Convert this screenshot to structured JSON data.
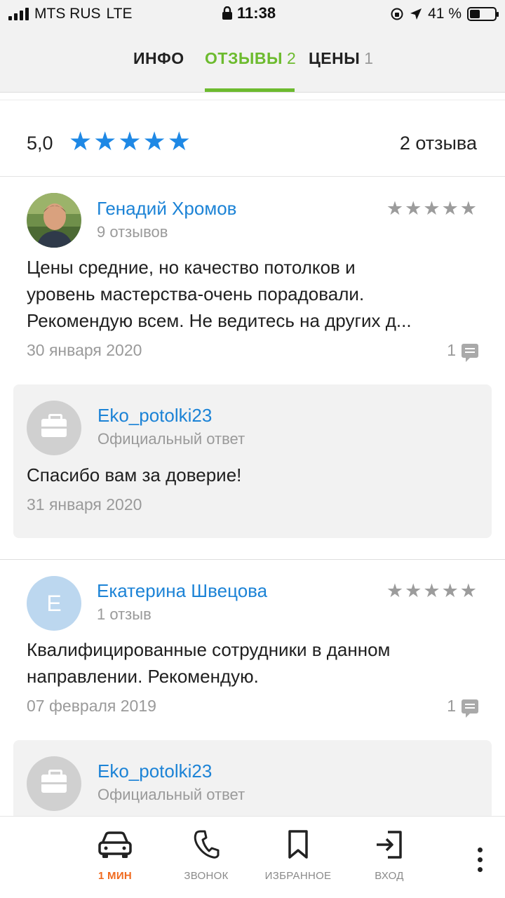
{
  "status_bar": {
    "carrier": "MTS RUS",
    "network": "LTE",
    "time": "11:38",
    "battery": "41 %",
    "battery_level": 0.41
  },
  "tabs": [
    {
      "label": "ИНФО",
      "count": "",
      "active": false
    },
    {
      "label": "ОТЗЫВЫ",
      "count": "2",
      "active": true
    },
    {
      "label": "ЦЕНЫ",
      "count": "1",
      "active": false
    }
  ],
  "colors": {
    "accent_green": "#6dbb2f",
    "link_blue": "#1c83d6",
    "star_blue": "#1e88e5",
    "nav_accent": "#f06a1e"
  },
  "summary": {
    "score": "5,0",
    "stars": 5,
    "review_count": "2 отзыва"
  },
  "reviews": [
    {
      "author": "Генадий Хромов",
      "author_reviews": "9 отзывов",
      "rating": 5,
      "text_lines": [
        "Цены средние, но качество потолков и",
        "уровень мастерства-очень порадовали.",
        "Рекомендую всем. Не ведитесь на других д..."
      ],
      "date": "30 января 2020",
      "comments": "1",
      "reply": {
        "author": "Eko_potolki23",
        "label": "Официальный ответ",
        "text": "Спасибо вам за доверие!",
        "date": "31 января 2020"
      }
    },
    {
      "author": "Екатерина Швецова",
      "avatar_letter": "Е",
      "author_reviews": "1 отзыв",
      "rating": 5,
      "text_lines": [
        "Квалифицированные сотрудники в данном",
        "направлении. Рекомендую."
      ],
      "date": "07 февраля 2019",
      "comments": "1",
      "reply": {
        "author": "Eko_potolki23",
        "label": "Официальный ответ"
      }
    }
  ],
  "bottom_nav": [
    {
      "label": "1 МИН",
      "icon": "car-icon"
    },
    {
      "label": "ЗВОНОК",
      "icon": "phone-icon"
    },
    {
      "label": "ИЗБРАННОЕ",
      "icon": "bookmark-icon"
    },
    {
      "label": "ВХОД",
      "icon": "login-icon"
    }
  ]
}
